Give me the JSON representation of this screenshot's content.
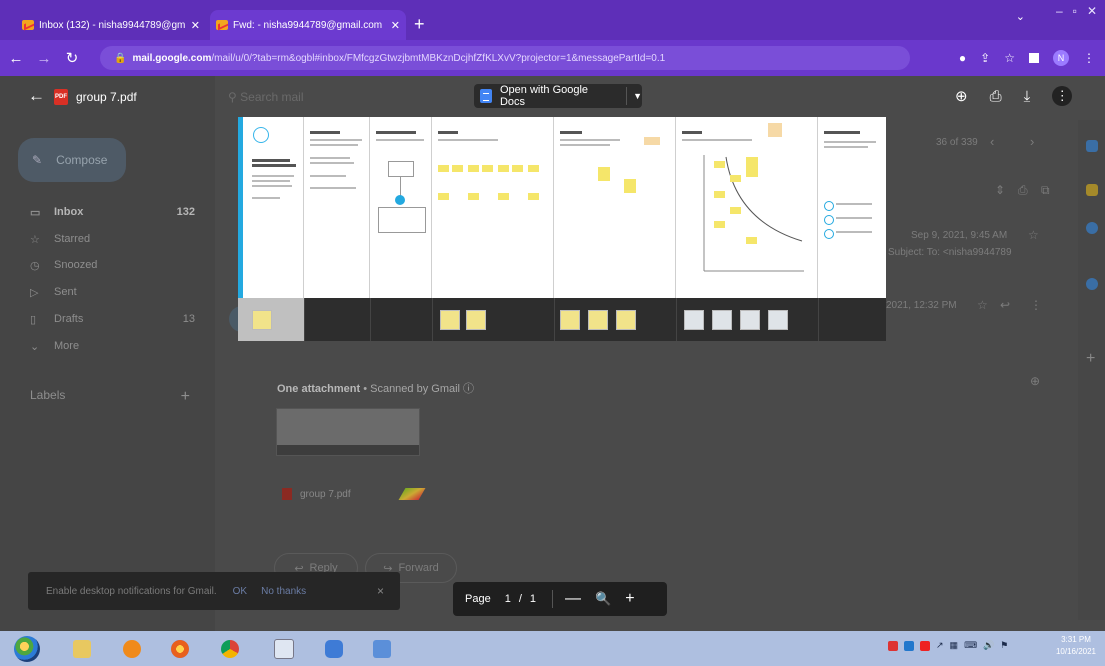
{
  "browser": {
    "tabs": [
      {
        "label": "Inbox (132) - nisha9944789@gm",
        "active": false
      },
      {
        "label": "Fwd: - nisha9944789@gmail.com",
        "active": true
      }
    ],
    "url_host": "mail.google.com",
    "url_rest": "/mail/u/0/?tab=rm&ogbl#inbox/FMfcgzGtwzjbmtMBKznDcjhfZfKLXvV?projector=1&messagePartId=0.1",
    "profile_initial": "N"
  },
  "viewer": {
    "filename": "group 7.pdf",
    "open_with_label": "Open with Google Docs",
    "page_label": "Page",
    "current_page": "1",
    "page_separator": "/",
    "total_pages": "1"
  },
  "gmail": {
    "compose_label": "Compose",
    "nav": [
      {
        "label": "Inbox",
        "count": "132"
      },
      {
        "label": "Starred",
        "count": ""
      },
      {
        "label": "Snoozed",
        "count": ""
      },
      {
        "label": "Sent",
        "count": ""
      },
      {
        "label": "Drafts",
        "count": "13"
      },
      {
        "label": "More",
        "count": ""
      }
    ],
    "labels_heading": "Labels",
    "search_placeholder": "Search mail",
    "pagination": "36 of 339",
    "email_date": "Sep 9, 2021, 9:45 AM",
    "email_subject_line": "Subject: To: <nisha9944789",
    "reply_time": "2021, 12:32 PM",
    "attachment_heading": "One attachment",
    "attachment_scanned": " • Scanned by Gmail ⓘ",
    "attachment_file": "group 7.pdf",
    "reply_button": "Reply",
    "forward_button": "Forward",
    "snackbar_text": "Enable desktop notifications for Gmail.",
    "snackbar_ok": "OK",
    "snackbar_no": "No thanks",
    "snackbar_close": "×"
  },
  "taskbar": {
    "clock_time": "3:31 PM",
    "clock_date": "10/16/2021"
  },
  "colors": {
    "tabbar": "#5e2fb8",
    "address_bar": "#6a38cc",
    "sticky_note": "#f5e66a",
    "accent_blue": "#23a9e0",
    "taskbar": "#aebfe0"
  }
}
